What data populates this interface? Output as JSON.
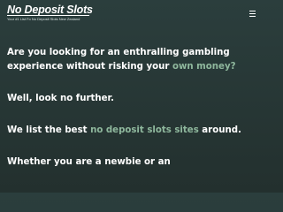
{
  "header": {
    "logo_title": "No Deposit Slots",
    "logo_tagline": "Your #1 List Fo No Deposit Slots New Zealand",
    "menu_icon": "hamburger-menu-icon"
  },
  "colors": {
    "background_top": "#2b3e3d",
    "background_bottom": "#23302e",
    "text": "#ffffff",
    "accent": "#8fb89d"
  },
  "content": {
    "p1": {
      "before": "Are you looking for an enthralling gambling experience without risking your ",
      "link": "own money?"
    },
    "p2": {
      "text": "Well, look no further."
    },
    "p3": {
      "before": "We list the best ",
      "link": "no deposit slots sites",
      "after": " around."
    },
    "p4": {
      "text": "Whether you are a newbie or an"
    }
  }
}
